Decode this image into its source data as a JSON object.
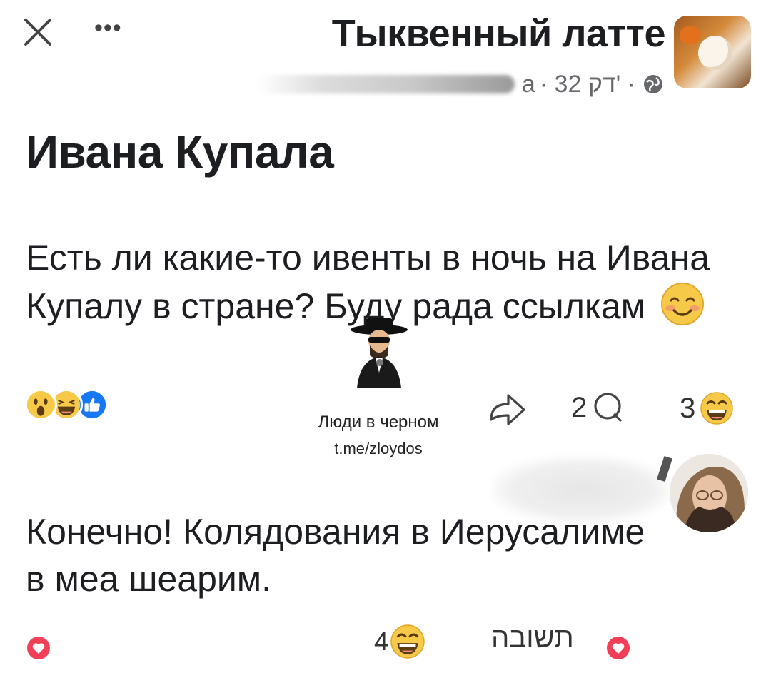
{
  "header": {
    "close_icon": "close-icon",
    "more_label": "•••",
    "group_title": "Тыквенный латте",
    "author_suffix": "а",
    "time": "· 32 דק' ·",
    "visibility_icon": "globe-icon"
  },
  "post": {
    "title": "Ивана Купала",
    "body": "Есть ли какие-то ивенты в ночь на Ивана Купалу в стране? Буду рада ссылкам",
    "body_emoji": "smiling-face-icon",
    "reaction_icons": [
      "wow-icon",
      "haha-icon",
      "like-icon"
    ],
    "comments_count": "2",
    "laugh_count": "3"
  },
  "watermark": {
    "title": "Люди в черном",
    "link": "t.me/zloydos"
  },
  "comment": {
    "text": "Конечно! Колядования в Иерусалиме в меа шеарим.",
    "laugh_count": "4",
    "reply_label": "תשובה"
  },
  "colors": {
    "text": "#1c1e21",
    "muted": "#65676b",
    "like_blue": "#1877f2",
    "emoji_yellow": "#f7c948",
    "heart_pink": "#f33e58"
  }
}
